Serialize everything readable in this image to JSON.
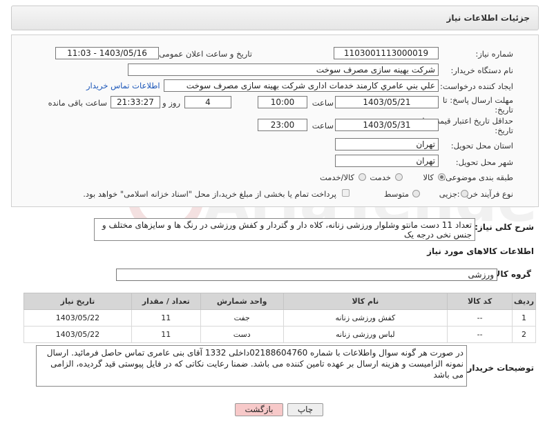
{
  "header": {
    "title": "جزئیات اطلاعات نیاز"
  },
  "form": {
    "need_number_label": "شماره نیاز:",
    "need_number": "1103001113000019",
    "announce_label": "تاریخ و ساعت اعلان عمومی:",
    "announce_value": "1403/05/16 - 11:03",
    "buyer_org_label": "نام دستگاه خریدار:",
    "buyer_org": "شرکت بهینه سازی مصرف سوخت",
    "requester_label": "ایجاد کننده درخواست:",
    "requester": "علي بني عامري كارمند خدمات اداری شرکت بهینه سازی مصرف سوخت",
    "contact_link": "اطلاعات تماس خریدار",
    "deadline_label_1": "مهلت ارسال پاسخ: تا",
    "deadline_label_2": "تاریخ:",
    "deadline_date": "1403/05/21",
    "time_label": "ساعت",
    "deadline_time": "10:00",
    "days_value": "4",
    "days_label": "روز و",
    "remaining_value": "21:33:27",
    "remaining_label": "ساعت باقی مانده",
    "validity_label_1": "حداقل تاریخ اعتبار قیمت: تا",
    "validity_label_2": "تاریخ:",
    "validity_date": "1403/05/31",
    "validity_time": "23:00",
    "province_label": "استان محل تحویل:",
    "province": "تهران",
    "city_label": "شهر محل تحویل:",
    "city": "تهران",
    "category_label": "طبقه بندی موضوعی:",
    "category_options": [
      "کالا",
      "خدمت",
      "کالا/خدمت"
    ],
    "process_label": "نوع فرآیند خرید :",
    "process_options": [
      "جزیی",
      "متوسط"
    ],
    "payment_note": "پرداخت تمام یا بخشی از مبلغ خرید،از محل \"اسناد خزانه اسلامی\" خواهد بود."
  },
  "description": {
    "label": "شرح کلی نیاز:",
    "text": "تعداد 11 دست مانتو وشلوار ورزشی زنانه، کلاه دار و گتردار و کفش ورزشی در رنگ ها و سایزهای مختلف و جنس نخی درجه یک"
  },
  "goods": {
    "section_title": "اطلاعات کالاهای مورد نیاز",
    "group_label": "گروه کالا:",
    "group_value": "ورزشی",
    "columns": [
      "ردیف",
      "کد کالا",
      "نام کالا",
      "واحد شمارش",
      "تعداد / مقدار",
      "تاریخ نیاز"
    ],
    "rows": [
      [
        "1",
        "--",
        "کفش ورزشی زنانه",
        "جفت",
        "11",
        "1403/05/22"
      ],
      [
        "2",
        "--",
        "لباس ورزشی زنانه",
        "دست",
        "11",
        "1403/05/22"
      ]
    ]
  },
  "buyer_notes": {
    "label": "توضیحات خریدار:",
    "text": "در صورت هر گونه سوال واطلاعات با شماره 02188604760داخلی 1332 آقای بنی عامری تماس حاصل فرمائید. ارسال نمونه الزامیست و هزینه ارسال بر عهده تامین کننده می باشد. ضمنا رعایت نکاتی که در فایل پیوستی قید گردیده، الزامی می باشد"
  },
  "buttons": {
    "print": "چاپ",
    "back": "بازگشت"
  },
  "colors": {
    "back_button_bg": "#f7c9c9",
    "print_button_bg": "#eeeeee",
    "link": "#1a55b8"
  }
}
